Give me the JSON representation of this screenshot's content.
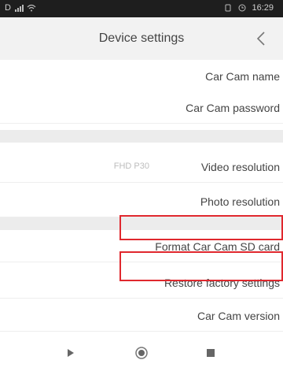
{
  "status_bar": {
    "left_text": "D",
    "time": "16:29"
  },
  "header": {
    "title": "Device settings",
    "back_icon": "chevron-left-icon"
  },
  "settings": {
    "items": [
      {
        "label": "Car Cam name"
      },
      {
        "label": "Car Cam password"
      },
      {
        "label": "Video resolution",
        "value": "FHD P30"
      },
      {
        "label": "Photo resolution"
      },
      {
        "label": "Format Car Cam SD card"
      },
      {
        "label": "Restore factory settings"
      },
      {
        "label": "Car Cam version"
      }
    ]
  },
  "highlight_color": "#e0282e",
  "navbar": {
    "icons": [
      "back-triangle-icon",
      "home-circle-icon",
      "recents-square-icon"
    ]
  }
}
